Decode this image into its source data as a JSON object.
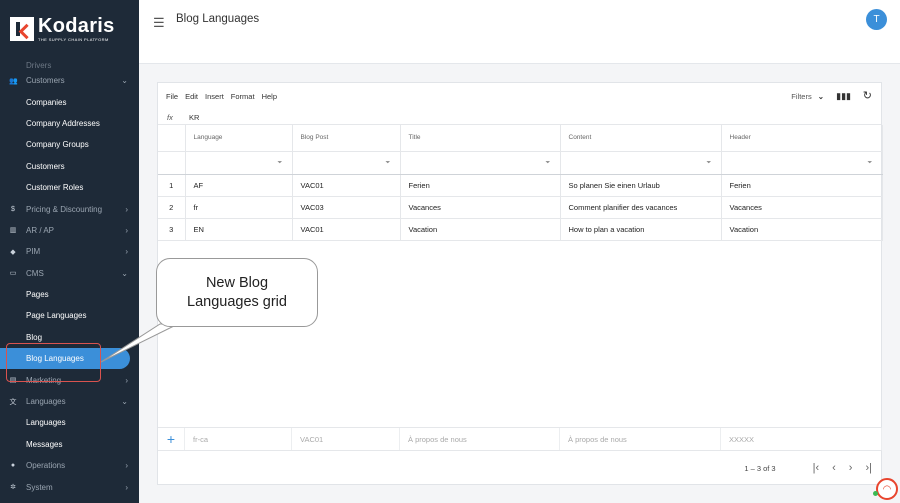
{
  "app": {
    "logo_name": "Kodaris",
    "logo_tagline": "THE SUPPLY CHAIN PLATFORM"
  },
  "header": {
    "title": "Blog Languages",
    "avatar_initial": "T"
  },
  "sidebar": {
    "partial_item": "Drivers",
    "items": [
      {
        "label": "Customers",
        "type": "section",
        "icon": "users-icon",
        "glyph": "👥",
        "chevron": "⌄"
      },
      {
        "label": "Companies",
        "type": "sub"
      },
      {
        "label": "Company Addresses",
        "type": "sub"
      },
      {
        "label": "Company Groups",
        "type": "sub"
      },
      {
        "label": "Customers",
        "type": "sub"
      },
      {
        "label": "Customer Roles",
        "type": "sub"
      },
      {
        "label": "Pricing & Discounting",
        "type": "section",
        "icon": "dollar-icon",
        "glyph": "$",
        "chevron": "›"
      },
      {
        "label": "AR / AP",
        "type": "section",
        "icon": "bank-icon",
        "glyph": "▥",
        "chevron": "›"
      },
      {
        "label": "PIM",
        "type": "section",
        "icon": "tag-icon",
        "glyph": "◆",
        "chevron": "›"
      },
      {
        "label": "CMS",
        "type": "section",
        "icon": "window-icon",
        "glyph": "▭",
        "chevron": "⌄"
      },
      {
        "label": "Pages",
        "type": "sub"
      },
      {
        "label": "Page Languages",
        "type": "sub"
      },
      {
        "label": "Blog",
        "type": "sub"
      },
      {
        "label": "Blog Languages",
        "type": "sub",
        "active": true
      },
      {
        "label": "Marketing",
        "type": "section",
        "icon": "megaphone-icon",
        "glyph": "▤",
        "chevron": "›"
      },
      {
        "label": "Languages",
        "type": "section",
        "icon": "translate-icon",
        "glyph": "文",
        "chevron": "⌄"
      },
      {
        "label": "Languages",
        "type": "sub"
      },
      {
        "label": "Messages",
        "type": "sub"
      },
      {
        "label": "Operations",
        "type": "section",
        "icon": "operations-icon",
        "glyph": "●",
        "chevron": "›"
      },
      {
        "label": "System",
        "type": "section",
        "icon": "gear-icon",
        "glyph": "✲",
        "chevron": "›"
      }
    ]
  },
  "toolbar": {
    "menus": [
      "File",
      "Edit",
      "Insert",
      "Format",
      "Help"
    ],
    "filters_label": "Filters",
    "formula_label": "fx",
    "formula_value": "KR"
  },
  "grid": {
    "columns": [
      "Language",
      "Blog Post",
      "Title",
      "Content",
      "Header"
    ],
    "rows": [
      {
        "num": "1",
        "cells": [
          "AF",
          "VAC01",
          "Ferien",
          "So planen Sie einen Urlaub",
          "Ferien"
        ]
      },
      {
        "num": "2",
        "cells": [
          "fr",
          "VAC03",
          "Vacances",
          "Comment planifier des vacances",
          "Vacances"
        ]
      },
      {
        "num": "3",
        "cells": [
          "EN",
          "VAC01",
          "Vacation",
          "How to plan a vacation",
          "Vacation"
        ]
      }
    ],
    "new_row_placeholders": [
      "fr-ca",
      "VAC01",
      "À propos de nous",
      "À propos de nous",
      "XXXXX"
    ],
    "pagination": "1 – 3 of 3"
  },
  "callout": {
    "line1": "New Blog",
    "line2": "Languages grid"
  }
}
